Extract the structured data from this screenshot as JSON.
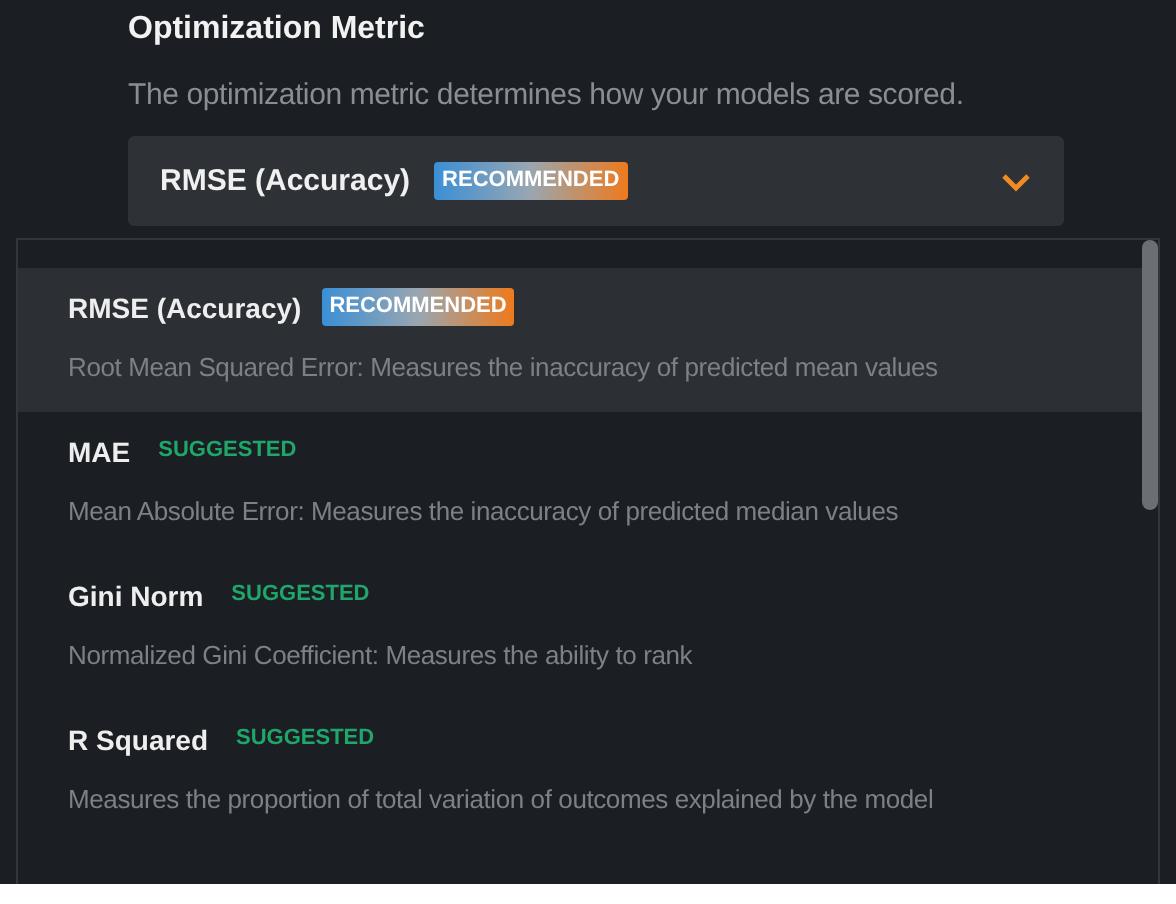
{
  "field": {
    "label": "Optimization Metric",
    "description": "The optimization metric determines how your models are scored.",
    "value": "RMSE (Accuracy)",
    "badge": {
      "kind": "recommended",
      "text": "RECOMMENDED"
    }
  },
  "options": [
    {
      "name": "RMSE (Accuracy)",
      "badge": {
        "kind": "recommended",
        "text": "RECOMMENDED"
      },
      "description": "Root Mean Squared Error: Measures the inaccuracy of predicted mean values",
      "selected": true
    },
    {
      "name": "MAE",
      "badge": {
        "kind": "suggested",
        "text": "SUGGESTED"
      },
      "description": "Mean Absolute Error: Measures the inaccuracy of predicted median values",
      "selected": false
    },
    {
      "name": "Gini Norm",
      "badge": {
        "kind": "suggested",
        "text": "SUGGESTED"
      },
      "description": "Normalized Gini Coefficient: Measures the ability to rank",
      "selected": false
    },
    {
      "name": "R Squared",
      "badge": {
        "kind": "suggested",
        "text": "SUGGESTED"
      },
      "description": "Measures the proportion of total variation of outcomes explained by the model",
      "selected": false
    }
  ]
}
